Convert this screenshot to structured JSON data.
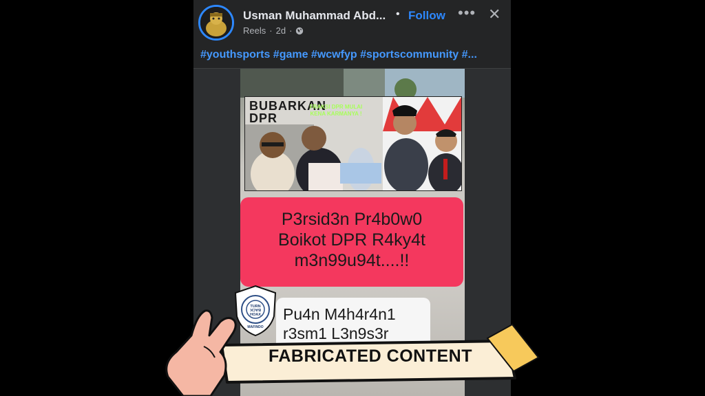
{
  "post": {
    "author": "Usman Muhammad Abd...",
    "separator": "•",
    "follow_label": "Follow",
    "more_icon": "•••",
    "close_icon": "✕",
    "meta_source": "Reels",
    "meta_sep": "·",
    "meta_time": "2d",
    "hashtags": "#youthsports #game #wcwfyp #sportscommunity #..."
  },
  "video": {
    "thumbnail": {
      "sign_text": "BUBARKAN\nDPR",
      "caption": "FRAKSI DPR MULAI KENA KARMANYA !"
    },
    "red_card_lines": [
      "P3rsid3n Pr4b0w0",
      "Boikot DPR R4ky4t",
      "m3n99u94t....!!"
    ],
    "white_card_lines": [
      "Pu4n M4h4r4n1",
      "r3sm1 L3n9s3r"
    ]
  },
  "overlay": {
    "badge": {
      "center_text": "TURN BACK HOAX",
      "ring_text": "MASYARAKAT ANTI FITNAH INDONESIA",
      "bottom_text": "MAFINDO"
    },
    "banner_label": "FABRICATED CONTENT",
    "colors": {
      "banner_fill": "#fbeed6",
      "tape": "#f7c95b",
      "hand": "#f5b7a4",
      "accent_blue": "#2d88ff"
    }
  }
}
